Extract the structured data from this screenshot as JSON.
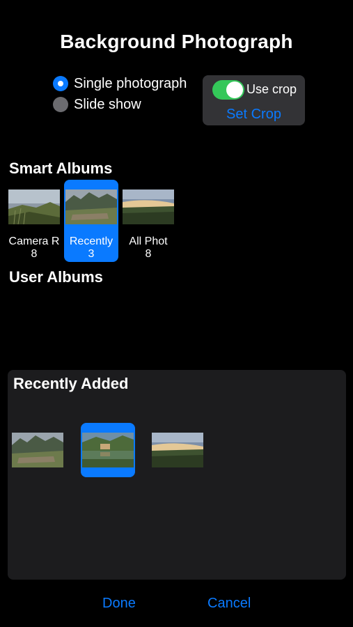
{
  "header": {
    "title": "Background Photograph"
  },
  "mode": {
    "options": [
      {
        "label": "Single photograph",
        "selected": true
      },
      {
        "label": "Slide show",
        "selected": false
      }
    ]
  },
  "crop": {
    "use_crop_label": "Use crop",
    "use_crop_on": true,
    "set_crop_label": "Set Crop"
  },
  "smart_albums": {
    "heading": "Smart Albums",
    "items": [
      {
        "name": "Camera R",
        "count": "8",
        "selected": false
      },
      {
        "name": "Recently",
        "count": "3",
        "selected": true
      },
      {
        "name": "All Phot",
        "count": "8",
        "selected": false
      }
    ]
  },
  "user_albums": {
    "heading": "User Albums"
  },
  "album_view": {
    "heading": "Recently Added",
    "photos": [
      {
        "subject": "mountain-ruins",
        "selected": false
      },
      {
        "subject": "lake-reflection",
        "selected": true
      },
      {
        "subject": "meadow-sunset",
        "selected": false
      }
    ]
  },
  "footer": {
    "done_label": "Done",
    "cancel_label": "Cancel"
  },
  "colors": {
    "accent": "#0a7aff",
    "toggle_on": "#34c759",
    "panel": "#1c1c1e",
    "crop_box": "#333336"
  }
}
